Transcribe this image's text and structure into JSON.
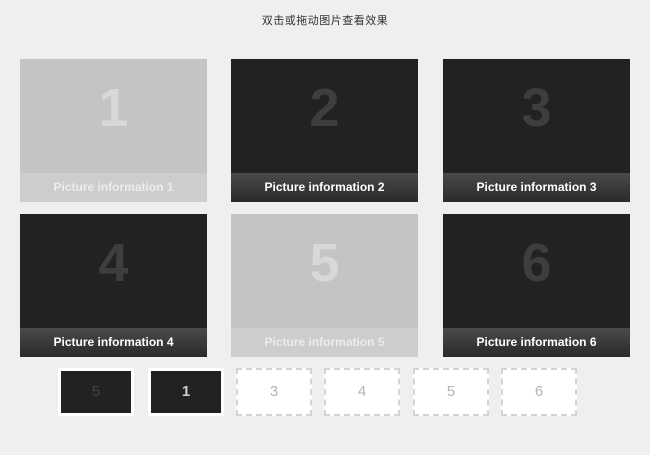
{
  "page": {
    "title": "双击或拖动图片查看效果"
  },
  "colors": {
    "background": "#efefef",
    "tile_dark": "#222222",
    "tile_light": "#c4c4c4",
    "caption_text": "#ffffff"
  },
  "tiles": [
    {
      "number": "1",
      "caption": "Picture information 1",
      "state": "faded"
    },
    {
      "number": "2",
      "caption": "Picture information 2",
      "state": "normal"
    },
    {
      "number": "3",
      "caption": "Picture information 3",
      "state": "normal"
    },
    {
      "number": "4",
      "caption": "Picture information 4",
      "state": "normal"
    },
    {
      "number": "5",
      "caption": "Picture information 5",
      "state": "faded"
    },
    {
      "number": "6",
      "caption": "Picture information 6",
      "state": "normal"
    }
  ],
  "thumbnails": [
    {
      "label": "5",
      "state": "filled"
    },
    {
      "label": "1",
      "state": "filled-active"
    },
    {
      "label": "3",
      "state": "empty"
    },
    {
      "label": "4",
      "state": "empty"
    },
    {
      "label": "5",
      "state": "empty"
    },
    {
      "label": "6",
      "state": "empty"
    }
  ]
}
